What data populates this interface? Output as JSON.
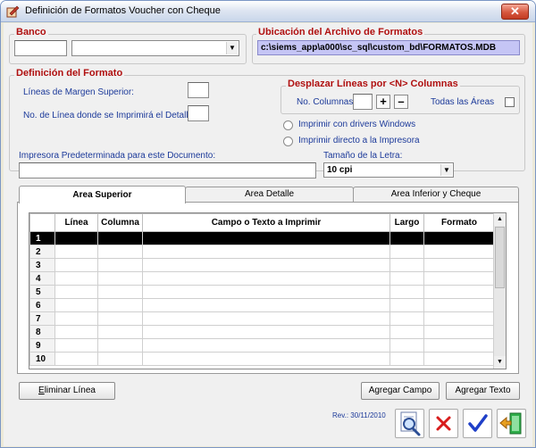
{
  "window": {
    "title": "Definición de Formatos Voucher con Cheque",
    "close_glyph": "✕"
  },
  "banco": {
    "legend": "Banco",
    "code_value": "",
    "name_value": ""
  },
  "ubicacion": {
    "legend": "Ubicación del Archivo de Formatos",
    "path": "c:\\siems_app\\a000\\sc_sql\\custom_bd\\FORMATOS.MDB"
  },
  "definicion": {
    "legend": "Definición del Formato",
    "margen_label": "Líneas de Margen Superior:",
    "margen_value": "",
    "linea_detalle_label": "No. de Línea donde se Imprimirá el Detalle:",
    "linea_detalle_value": ""
  },
  "desplazar": {
    "legend": "Desplazar Líneas por <N> Columnas",
    "columnas_label": "No. Columnas:",
    "columnas_value": "",
    "plus": "+",
    "minus": "–",
    "todas_label": "Todas las Áreas",
    "todas_checked": false
  },
  "print_mode": {
    "options": [
      "Imprimir con drivers Windows",
      "Imprimir directo a la Impresora"
    ],
    "selected": null
  },
  "impresora": {
    "label": "Impresora Predeterminada para este Documento:",
    "value": ""
  },
  "letra": {
    "label": "Tamaño de la Letra:",
    "value": "10 cpi"
  },
  "tabs": [
    {
      "label": "Area Superior",
      "active": true
    },
    {
      "label": "Area Detalle",
      "active": false
    },
    {
      "label": "Area Inferior y Cheque",
      "active": false
    }
  ],
  "grid": {
    "columns": [
      "",
      "Línea",
      "Columna",
      "Campo o Texto a Imprimir",
      "Largo",
      "Formato"
    ],
    "rows": [
      {
        "n": "1",
        "linea": "",
        "columna": "",
        "campo": "",
        "largo": "",
        "formato": ""
      },
      {
        "n": "2",
        "linea": "",
        "columna": "",
        "campo": "",
        "largo": "",
        "formato": ""
      },
      {
        "n": "3",
        "linea": "",
        "columna": "",
        "campo": "",
        "largo": "",
        "formato": ""
      },
      {
        "n": "4",
        "linea": "",
        "columna": "",
        "campo": "",
        "largo": "",
        "formato": ""
      },
      {
        "n": "5",
        "linea": "",
        "columna": "",
        "campo": "",
        "largo": "",
        "formato": ""
      },
      {
        "n": "6",
        "linea": "",
        "columna": "",
        "campo": "",
        "largo": "",
        "formato": ""
      },
      {
        "n": "7",
        "linea": "",
        "columna": "",
        "campo": "",
        "largo": "",
        "formato": ""
      },
      {
        "n": "8",
        "linea": "",
        "columna": "",
        "campo": "",
        "largo": "",
        "formato": ""
      },
      {
        "n": "9",
        "linea": "",
        "columna": "",
        "campo": "",
        "largo": "",
        "formato": ""
      },
      {
        "n": "10",
        "linea": "",
        "columna": "",
        "campo": "",
        "largo": "",
        "formato": ""
      }
    ],
    "selected_row": 0
  },
  "buttons": {
    "eliminar": "Eliminar Línea",
    "agregar_campo": "Agregar Campo",
    "agregar_texto": "Agregar Texto"
  },
  "revision": "Rev.: 30/11/2010",
  "toolbar": [
    {
      "name": "preview-icon"
    },
    {
      "name": "cancel-icon"
    },
    {
      "name": "accept-icon"
    },
    {
      "name": "exit-icon"
    }
  ],
  "colors": {
    "legend_red": "#b01010",
    "label_blue": "#1c3a9a",
    "path_bg": "#c5c5f5",
    "selected_row": "#000000",
    "cancel_red": "#d81c1c",
    "accept_blue": "#1f3fc8"
  }
}
